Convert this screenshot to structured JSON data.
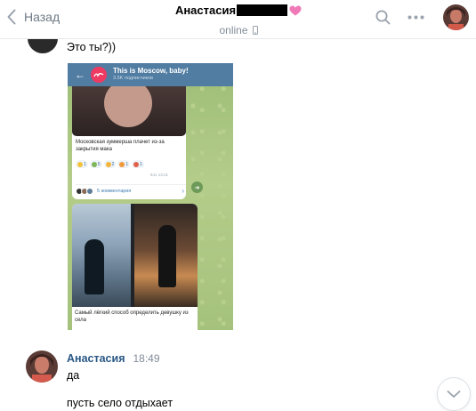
{
  "header": {
    "back_label": "Назад",
    "peer_name": "Анастасия",
    "peer_status": "online",
    "icons": [
      "chevron-left-icon",
      "search-icon",
      "more-dots-icon",
      "heart-icon",
      "phone-icon"
    ]
  },
  "messages": [
    {
      "text": "Это ты?))"
    },
    {
      "author": "Анастасия",
      "time": "18:49",
      "lines": [
        "да",
        "пусть село отдыхает"
      ]
    }
  ],
  "screenshot": {
    "channel_name": "This is Moscow, baby!",
    "channel_subs": "3.5K подписчиков",
    "post1_caption": "Московская зуммерша плачет из-за закрытия мака",
    "reactions": [
      "1",
      "5",
      "2",
      "1",
      "1"
    ],
    "post1_meta": "641 13:21",
    "comments_label": "5 комментария",
    "post2_caption": "Самый лёгкий способ определить девушку из села"
  },
  "colors": {
    "link_blue": "#2a5885",
    "muted_text": "#818c99",
    "telegram_header": "#517da2",
    "chat_wallpaper": "#a7c37d",
    "heart_pink": "#e64f9b"
  }
}
